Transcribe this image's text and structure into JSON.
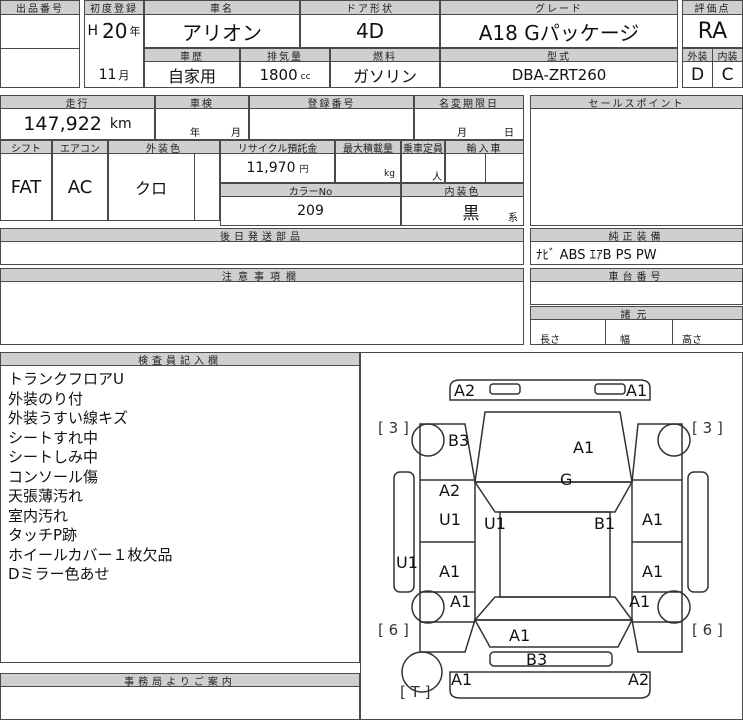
{
  "labels": {
    "lot_no": "出品番号",
    "first_reg": "初度登録",
    "car_name": "車名",
    "door_type": "ドア形状",
    "grade": "グレード",
    "score": "評価点",
    "history": "車歴",
    "displacement": "排気量",
    "fuel": "燃料",
    "model_type": "型式",
    "exterior": "外装",
    "interior": "内装",
    "mileage": "走行",
    "inspection": "車検",
    "reg_no": "登録番号",
    "transfer_deadline": "名変期限日",
    "sales_point": "セールスポイント",
    "shift": "シフト",
    "aircon": "エアコン",
    "ext_color": "外装色",
    "recycle": "リサイクル預託金",
    "max_load": "最大積載量",
    "capacity": "乗車定員",
    "import": "輸入車",
    "color_no": "カラーNo",
    "int_color": "内装色",
    "later_parts": "後日発送部品",
    "genuine_equip": "純正装備",
    "caution": "注意事項欄",
    "chassis_no": "車台番号",
    "specs": "諸元",
    "inspector_notes": "検査員記入欄",
    "office_notice": "事務局よりご案内"
  },
  "units": {
    "year": "年",
    "month": "月",
    "day": "日",
    "cc": "cc",
    "km": "km",
    "yen": "円",
    "kg": "kg",
    "person": "人",
    "series": "系",
    "length": "長さ",
    "width": "幅",
    "height": "高さ"
  },
  "values": {
    "era": "H",
    "year": "20",
    "month": "11",
    "car_name": "アリオン",
    "door_type": "4D",
    "grade": "A18 Gパッケージ",
    "score": "RA",
    "history": "自家用",
    "displacement": "1800",
    "fuel": "ガソリン",
    "model_type": "DBA-ZRT260",
    "exterior_grade": "D",
    "interior_grade": "C",
    "mileage": "147,922",
    "shift": "FAT",
    "aircon": "AC",
    "ext_color": "クロ",
    "recycle": "11,970",
    "color_no": "209",
    "int_color": "黒",
    "equipment": "ﾅﾋﾞ ABS ｴｱB PS PW"
  },
  "notes": [
    "トランクフロアU",
    "外装のり付",
    "外装うすい線キズ",
    "シートすれ中",
    "シートしみ中",
    "コンソール傷",
    "天張薄汚れ",
    "室内汚れ",
    "タッチP跡",
    "ホイールカバー１枚欠品",
    "Dミラー色あせ"
  ],
  "damage": {
    "front_left": "A2",
    "front_right": "A1",
    "tire_fl": "3",
    "tire_fr": "3",
    "fender_fl": "B3",
    "hood": "A1",
    "windshield": "G",
    "door_fl": "A2",
    "door_fl_lower": "U1",
    "roof_left": "U1",
    "roof_right": "B1",
    "door_fr": "A1",
    "rocker_left": "U1",
    "door_rl": "A1",
    "door_rr": "A1",
    "fender_rl": "A1",
    "fender_rr": "A1",
    "tire_rl": "6",
    "tire_rr": "6",
    "trunk": "A1",
    "rear_bumper": "B3",
    "rear_left": "A1",
    "rear_right": "A2",
    "spare": "T"
  }
}
